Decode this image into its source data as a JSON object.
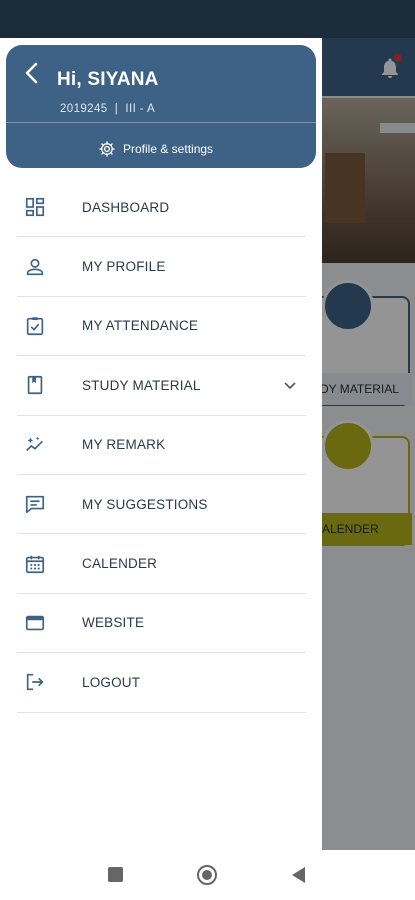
{
  "drawer": {
    "greeting": "Hi, SIYANA",
    "student_id": "2019245",
    "separator": "|",
    "class_section": "III - A",
    "settings_label": "Profile & settings",
    "items": [
      {
        "label": "DASHBOARD",
        "icon": "dashboard-icon"
      },
      {
        "label": "MY PROFILE",
        "icon": "person-icon"
      },
      {
        "label": "MY ATTENDANCE",
        "icon": "attendance-check-icon"
      },
      {
        "label": "STUDY MATERIAL",
        "icon": "book-icon",
        "expandable": true
      },
      {
        "label": "MY REMARK",
        "icon": "sparkle-trend-icon"
      },
      {
        "label": "MY SUGGESTIONS",
        "icon": "chat-icon"
      },
      {
        "label": "CALENDER",
        "icon": "calendar-icon"
      },
      {
        "label": "WEBSITE",
        "icon": "browser-window-icon"
      },
      {
        "label": "LOGOUT",
        "icon": "logout-icon"
      }
    ]
  },
  "background": {
    "card_study_label": "DY MATERIAL",
    "card_calendar_label": "ALENDER"
  },
  "colors": {
    "primary": "#3d6285",
    "accent_yellow": "#b9b51a",
    "status_bar": "#1d2c3a",
    "text": "#2b3a48"
  }
}
